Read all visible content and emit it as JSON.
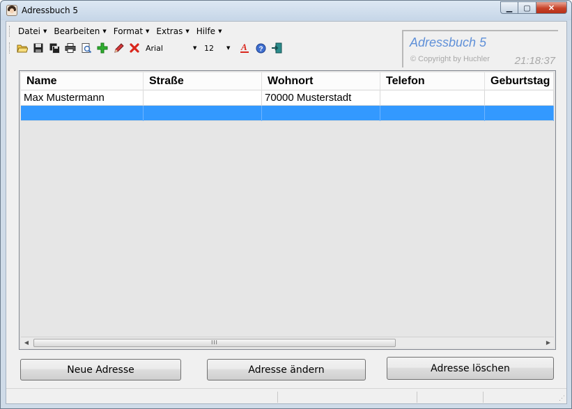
{
  "window": {
    "title": "Adressbuch 5"
  },
  "menu": [
    {
      "label": "Datei"
    },
    {
      "label": "Bearbeiten"
    },
    {
      "label": "Format"
    },
    {
      "label": "Extras"
    },
    {
      "label": "Hilfe"
    }
  ],
  "toolbar": {
    "icons": [
      "open-folder-icon",
      "save-icon",
      "save-all-icon",
      "print-icon",
      "print-preview-icon",
      "add-icon",
      "edit-pencil-icon",
      "delete-icon"
    ],
    "font_name": "Arial",
    "font_size": "12",
    "extra_icons": [
      "font-color-icon",
      "help-icon",
      "exit-icon"
    ]
  },
  "brand": {
    "title": "Adressbuch 5",
    "copyright": "© Copyright by Huchler",
    "clock": "21:18:37"
  },
  "table": {
    "columns": [
      "Name",
      "Straße",
      "Wohnort",
      "Telefon",
      "Geburtstag"
    ],
    "rows": [
      [
        "Max Mustermann",
        "",
        "70000 Musterstadt",
        "",
        ""
      ],
      [
        "",
        "",
        "",
        "",
        ""
      ]
    ],
    "selected_row": 1
  },
  "buttons": {
    "new": "Neue Adresse",
    "edit": "Adresse ändern",
    "delete": "Adresse löschen"
  },
  "colors": {
    "selection": "#3399ff",
    "brand_title": "#5f90d8",
    "delete_icon": "#d9261c",
    "add_icon": "#2fae2f"
  }
}
